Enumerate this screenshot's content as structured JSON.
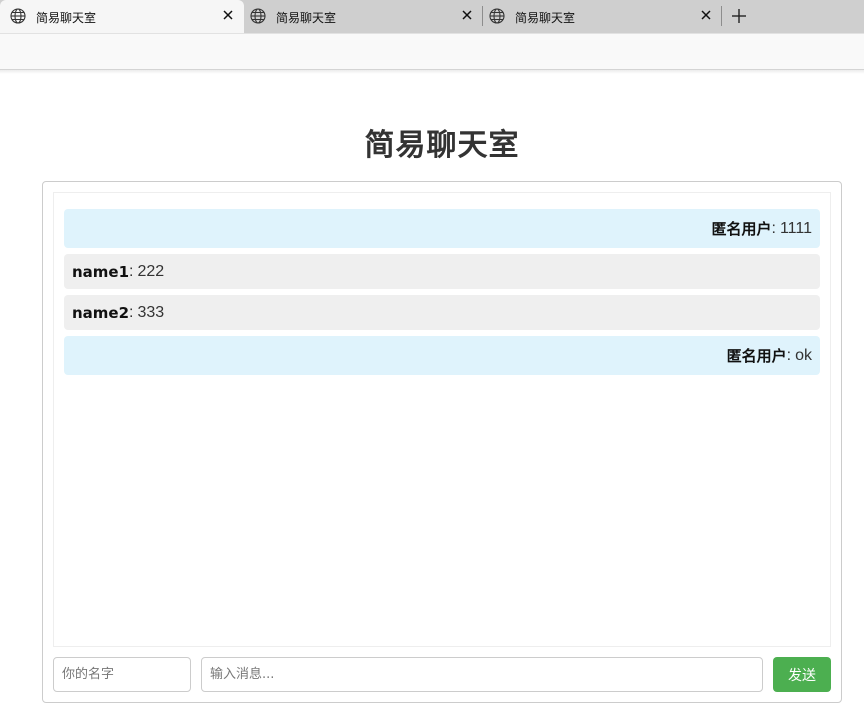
{
  "browser": {
    "tabs": [
      {
        "title": "简易聊天室",
        "active": true
      },
      {
        "title": "简易聊天室",
        "active": false
      },
      {
        "title": "简易聊天室",
        "active": false
      }
    ]
  },
  "page": {
    "title": "简易聊天室"
  },
  "messages": [
    {
      "sender": "匿名用户",
      "separator": ":",
      "text": "1111",
      "self": true
    },
    {
      "sender": "name1",
      "separator": ":",
      "text": "222",
      "self": false
    },
    {
      "sender": "name2",
      "separator": ":",
      "text": "333",
      "self": false
    },
    {
      "sender": "匿名用户",
      "separator": ":",
      "text": "ok",
      "self": true
    }
  ],
  "composer": {
    "name_placeholder": "你的名字",
    "message_placeholder": "输入消息...",
    "send_label": "发送"
  },
  "colors": {
    "self_bubble": "#dff3fc",
    "other_bubble": "#efefef",
    "send_button": "#4caf50"
  }
}
